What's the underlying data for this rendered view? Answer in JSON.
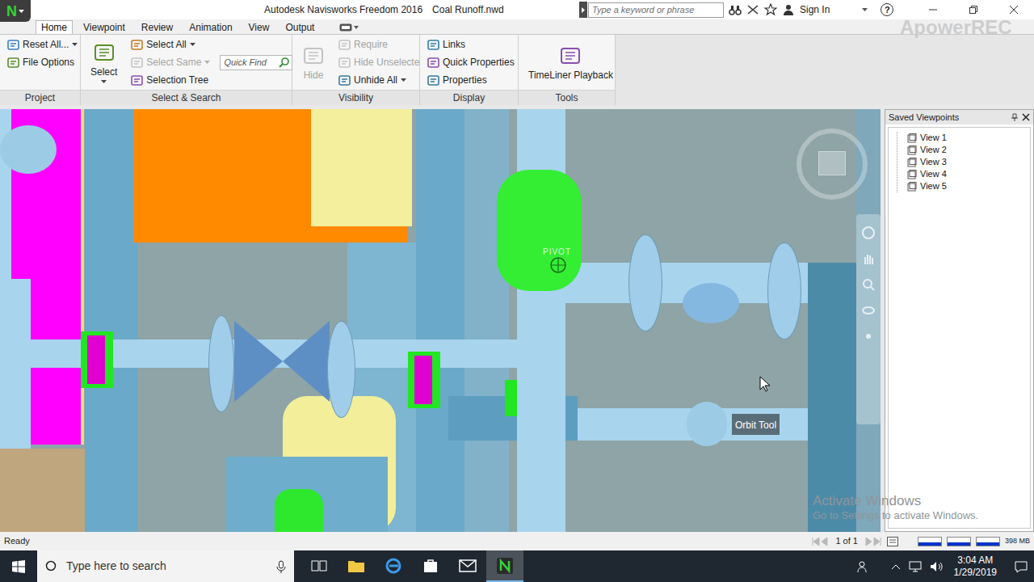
{
  "window": {
    "app_icon": "N",
    "title": "Autodesk Navisworks Freedom 2016",
    "file": "Coal Runoff.nwd"
  },
  "search": {
    "placeholder": "Type a keyword or phrase"
  },
  "account": {
    "sign_in": "Sign In"
  },
  "help": "?",
  "recorder_watermark": "ApowerREC",
  "ribbon_tabs": [
    {
      "label": "Home",
      "selected": true
    },
    {
      "label": "Viewpoint",
      "selected": false
    },
    {
      "label": "Review",
      "selected": false
    },
    {
      "label": "Animation",
      "selected": false
    },
    {
      "label": "View",
      "selected": false
    },
    {
      "label": "Output",
      "selected": false
    }
  ],
  "ribbon_groups": [
    {
      "label": "Project",
      "items": [
        {
          "kind": "small",
          "label": "Reset All...",
          "disabled": false,
          "dropdown": true
        },
        {
          "kind": "small",
          "label": "File Options",
          "disabled": false,
          "dropdown": false
        }
      ]
    },
    {
      "label": "Select & Search",
      "items": [
        {
          "kind": "large",
          "label": "Select",
          "disabled": false,
          "dropdown": true
        },
        {
          "kind": "small",
          "label": "Select All",
          "disabled": false,
          "dropdown": true
        },
        {
          "kind": "small",
          "label": "Select Same",
          "disabled": true,
          "dropdown": true
        },
        {
          "kind": "small",
          "label": "Selection Tree",
          "disabled": false,
          "dropdown": false
        },
        {
          "kind": "input",
          "label": "Quick Find",
          "disabled": false,
          "dropdown": false
        }
      ]
    },
    {
      "label": "Visibility",
      "items": [
        {
          "kind": "large",
          "label": "Hide",
          "disabled": true,
          "dropdown": false
        },
        {
          "kind": "small",
          "label": "Require",
          "disabled": true,
          "dropdown": false
        },
        {
          "kind": "small",
          "label": "Hide Unselected",
          "disabled": true,
          "dropdown": false
        },
        {
          "kind": "small",
          "label": "Unhide All",
          "disabled": false,
          "dropdown": true
        }
      ]
    },
    {
      "label": "Display",
      "items": [
        {
          "kind": "small",
          "label": "Links",
          "disabled": false,
          "dropdown": false
        },
        {
          "kind": "small",
          "label": "Quick Properties",
          "disabled": false,
          "dropdown": false
        },
        {
          "kind": "small",
          "label": "Properties",
          "disabled": false,
          "dropdown": false
        }
      ]
    },
    {
      "label": "Tools",
      "items": [
        {
          "kind": "large",
          "label": "TimeLiner Playback",
          "disabled": false,
          "dropdown": false
        }
      ]
    }
  ],
  "viewport": {
    "pivot_label": "PIVOT",
    "tooltip": "Orbit Tool"
  },
  "saved_viewpoints": {
    "title": "Saved Viewpoints",
    "items": [
      {
        "label": "View 1",
        "selected": false
      },
      {
        "label": "View 2",
        "selected": false
      },
      {
        "label": "View 3",
        "selected": false
      },
      {
        "label": "View 4",
        "selected": false
      },
      {
        "label": "View 5",
        "selected": false
      }
    ]
  },
  "status_bar": {
    "text": "Ready",
    "page": "1 of 1",
    "memory": "398 MB"
  },
  "activation": {
    "title": "Activate Windows",
    "subtitle": "Go to Settings to activate Windows."
  },
  "taskbar": {
    "search_placeholder": "Type here to search",
    "time": "3:04 AM",
    "date": "1/29/2019",
    "apps": [
      {
        "active": false
      },
      {
        "active": false
      },
      {
        "active": false
      },
      {
        "active": false
      },
      {
        "active": false
      },
      {
        "active": true
      }
    ]
  }
}
